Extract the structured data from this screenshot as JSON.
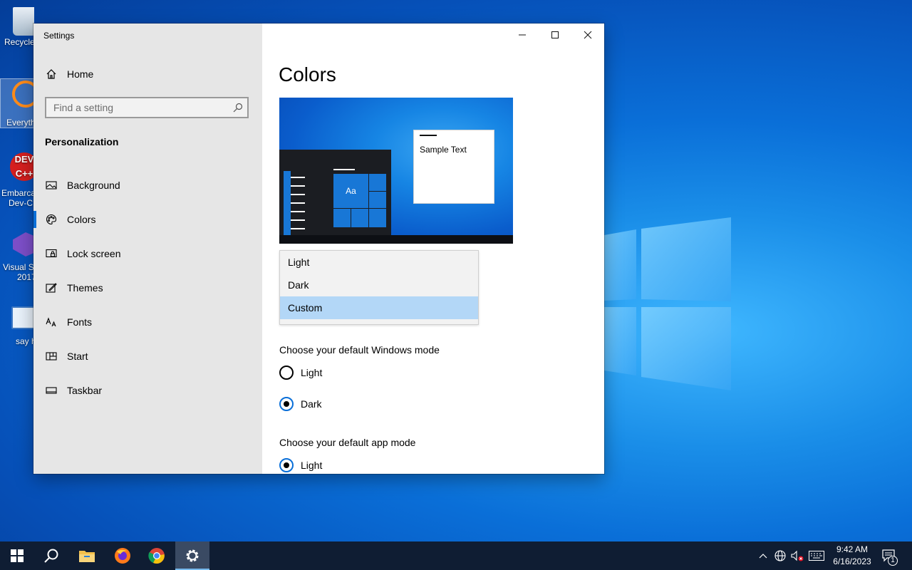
{
  "desktop": {
    "icons": [
      {
        "label": "Recycle"
      },
      {
        "label": "Everyth"
      },
      {
        "label": "Embarca"
      },
      {
        "label": "Dev-C"
      },
      {
        "label": "Visual St"
      },
      {
        "label": "2017"
      },
      {
        "label": "say h"
      }
    ]
  },
  "window": {
    "title": "Settings",
    "sidebar": {
      "home_label": "Home",
      "search_placeholder": "Find a setting",
      "section_title": "Personalization",
      "items": [
        {
          "label": "Background",
          "icon": "image-icon"
        },
        {
          "label": "Colors",
          "icon": "palette-icon"
        },
        {
          "label": "Lock screen",
          "icon": "lock-screen-icon"
        },
        {
          "label": "Themes",
          "icon": "themes-icon"
        },
        {
          "label": "Fonts",
          "icon": "fonts-icon"
        },
        {
          "label": "Start",
          "icon": "start-icon"
        },
        {
          "label": "Taskbar",
          "icon": "taskbar-icon"
        }
      ],
      "active_item": "Colors"
    },
    "main": {
      "heading": "Colors",
      "preview": {
        "sample_text": "Sample Text",
        "tile_text": "Aa"
      },
      "dropdown": {
        "options": [
          "Light",
          "Dark",
          "Custom"
        ],
        "selected": "Custom"
      },
      "windows_mode": {
        "label": "Choose your default Windows mode",
        "options": [
          "Light",
          "Dark"
        ],
        "selected": "Dark"
      },
      "app_mode": {
        "label": "Choose your default app mode",
        "options": [
          "Light"
        ],
        "selected": "Light"
      }
    }
  },
  "taskbar": {
    "time": "9:42 AM",
    "date": "6/16/2023",
    "notification_count": "1",
    "accent_color": "#76b9ed"
  }
}
